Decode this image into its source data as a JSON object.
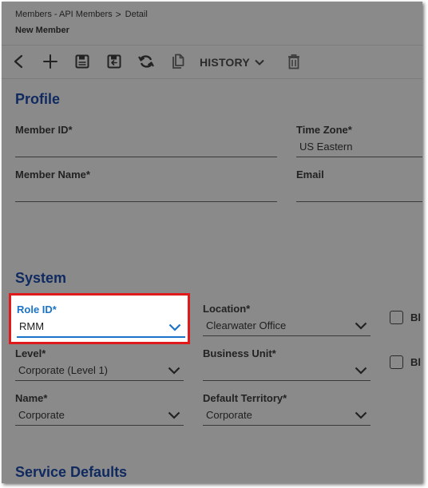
{
  "header": {
    "breadcrumb": {
      "root": "Members - API Members",
      "separator": ">",
      "current": "Detail"
    },
    "title": "New Member"
  },
  "toolbar": {
    "history_label": "HISTORY",
    "icons": [
      "back-arrow-icon",
      "plus-icon",
      "save-icon",
      "save-and-close-icon",
      "refresh-icon",
      "copy-icon",
      "chevron-down-icon",
      "trash-icon"
    ]
  },
  "profile": {
    "section_title": "Profile",
    "member_id_label": "Member ID*",
    "member_id_value": "",
    "time_zone_label": "Time Zone*",
    "time_zone_value": "US Eastern",
    "member_name_label": "Member Name*",
    "member_name_value": "",
    "email_label": "Email",
    "email_value": ""
  },
  "system": {
    "section_title": "System",
    "role_id_label": "Role ID*",
    "role_id_value": "RMM",
    "location_label": "Location*",
    "location_value": "Clearwater Office",
    "level_label": "Level*",
    "level_value": "Corporate (Level 1)",
    "business_unit_label": "Business Unit*",
    "business_unit_value": "",
    "name_label": "Name*",
    "name_value": "Corporate",
    "default_territory_label": "Default Territory*",
    "default_territory_value": "Corporate",
    "checkbox_1_text": "Bl",
    "checkbox_2_text": "Bl"
  },
  "service_defaults": {
    "section_title": "Service Defaults"
  },
  "colors": {
    "overlay_gray": "#8a8a8a",
    "section_title": "#102a60",
    "focus_blue": "#1b73c8",
    "highlight_red": "#e0191a"
  }
}
